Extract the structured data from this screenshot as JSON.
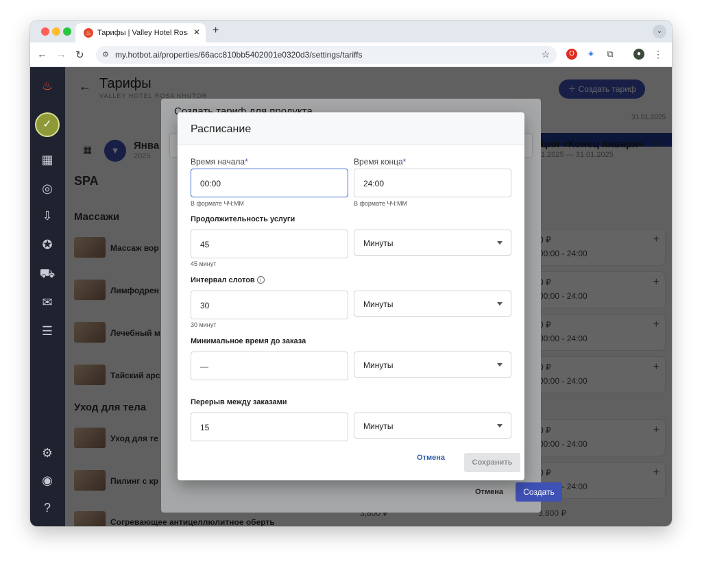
{
  "browser": {
    "tab_title": "Тарифы | Valley Hotel Rosa K",
    "url": "my.hotbot.ai/properties/66acc810bb5402001e0320d3/settings/tariffs"
  },
  "header": {
    "title": "Тарифы",
    "subtitle": "VALLEY HOTEL ROSA KHUTOR",
    "create_button": "Создать тариф"
  },
  "background": {
    "month_label": "Янва",
    "year_label": "2025",
    "promo_title": "ция «Конец января»",
    "promo_dates": "1.2025 — 31.01.2025",
    "date_right": "31.01.2025",
    "section_spa": "SPA",
    "section_massage": "Массажи",
    "section_body": "Уход для тела",
    "rows": [
      "Массаж вор",
      "Лимфодрен",
      "Лечебный м",
      "Тайский арс",
      "Уход для те",
      "Пилинг с кр",
      "Согревающее антицеллюлитное оберть"
    ],
    "card_price": "0 ₽",
    "card_time": "00:00 - 24:00",
    "bottom_price": "3,800 ₽",
    "bottom_price_right": "3,800 ₽"
  },
  "create_dialog": {
    "title": "Создать тариф для продукта",
    "cancel": "Отмена",
    "create": "Создать"
  },
  "schedule_dialog": {
    "title": "Расписание",
    "start_label": "Время начала",
    "end_label": "Время конца",
    "required_mark": "*",
    "start_value": "00:00",
    "end_value": "24:00",
    "time_hint": "В формате ЧЧ:ММ",
    "duration_label": "Продолжительность услуги",
    "duration_value": "45",
    "duration_unit": "Минуты",
    "duration_hint": "45 минут",
    "interval_label": "Интервал слотов",
    "interval_value": "30",
    "interval_unit": "Минуты",
    "interval_hint": "30 минут",
    "min_time_label": "Минимальное время до заказа",
    "min_time_value": "—",
    "min_time_unit": "Минуты",
    "break_label": "Перерыв между заказами",
    "break_value": "15",
    "break_unit": "Минуты",
    "cancel": "Отмена",
    "save": "Сохранить"
  }
}
